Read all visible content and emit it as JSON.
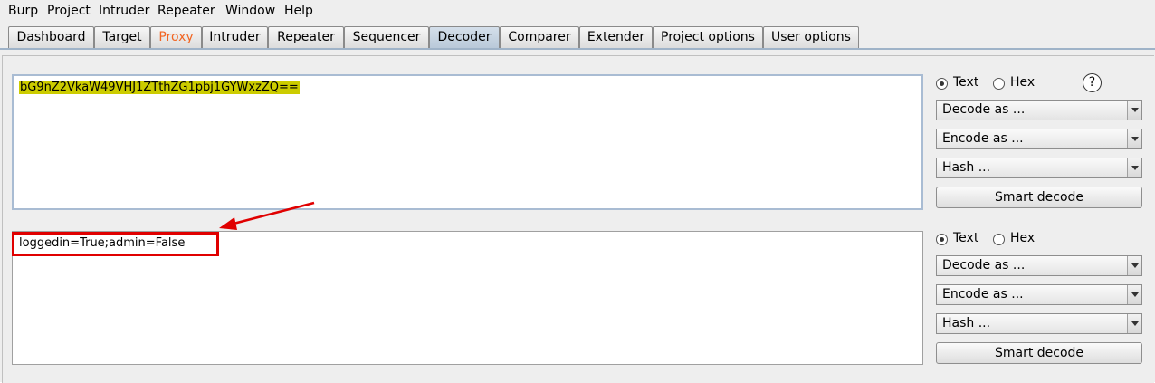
{
  "menu": [
    "Burp",
    "Project",
    "Intruder",
    "Repeater",
    "Window",
    "Help"
  ],
  "tabs": [
    "Dashboard",
    "Target",
    "Proxy",
    "Intruder",
    "Repeater",
    "Sequencer",
    "Decoder",
    "Comparer",
    "Extender",
    "Project options",
    "User options"
  ],
  "active_tab": "Decoder",
  "colors": {
    "proxy_tab": "#f26522",
    "highlight": "#cccc00",
    "annotation": "#e00000",
    "active_tab": "#c6d4e2"
  },
  "decoder": {
    "encoded_input": "bG9nZ2VkaW49VHJ1ZTthZG1pbj1GYWxzZQ==",
    "decoded_output": "loggedin=True;admin=False",
    "panel1": {
      "text_label": "Text",
      "hex_label": "Hex",
      "selected": "Text",
      "decode_label": "Decode as ...",
      "encode_label": "Encode as ...",
      "hash_label": "Hash ...",
      "smart_label": "Smart decode"
    },
    "panel2": {
      "text_label": "Text",
      "hex_label": "Hex",
      "selected": "Text",
      "decode_label": "Decode as ...",
      "encode_label": "Encode as ...",
      "hash_label": "Hash ...",
      "smart_label": "Smart decode"
    },
    "help_icon": "question-mark-circle-icon"
  }
}
